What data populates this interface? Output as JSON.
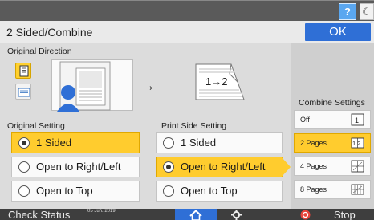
{
  "topbar": {
    "help_label": "?",
    "dark_mode_icon": "crescent-moon-icon"
  },
  "header": {
    "title": "2 Sided/Combine",
    "ok_label": "OK"
  },
  "original_direction": {
    "label": "Original Direction",
    "options": [
      {
        "icon": "portrait-document-icon",
        "selected": true
      },
      {
        "icon": "landscape-document-icon",
        "selected": false
      }
    ],
    "preview_icon": "original-on-glass-preview-icon",
    "flow_arrow": "→",
    "duplex_preview_text": "1→2"
  },
  "original_setting": {
    "label": "Original Setting",
    "options": [
      {
        "label": "1 Sided",
        "selected": true
      },
      {
        "label": "Open to Right/Left",
        "selected": false
      },
      {
        "label": "Open to Top",
        "selected": false
      }
    ]
  },
  "print_side_setting": {
    "label": "Print Side Setting",
    "options": [
      {
        "label": "1 Sided",
        "selected": false
      },
      {
        "label": "Open to Right/Left",
        "selected": true
      },
      {
        "label": "Open to Top",
        "selected": false
      }
    ]
  },
  "combine_settings": {
    "label": "Combine Settings",
    "options": [
      {
        "label": "Off",
        "selected": false,
        "icon": "combine-off-icon",
        "icon_text": "1"
      },
      {
        "label": "2 Pages",
        "selected": true,
        "icon": "combine-2-pages-icon",
        "icon_text": "1 2"
      },
      {
        "label": "4 Pages",
        "selected": false,
        "icon": "combine-4-pages-icon",
        "icon_text": ""
      },
      {
        "label": "8 Pages",
        "selected": false,
        "icon": "combine-8-pages-icon",
        "icon_text": ""
      }
    ]
  },
  "bottombar": {
    "check_status_label": "Check Status",
    "date_text": "05 Jun. 2019",
    "home_icon": "home-icon",
    "settings_icon": "gear-icon",
    "stop_icon": "stop-icon",
    "stop_label": "Stop"
  },
  "colors": {
    "selected": "#ffcc2e",
    "accent_blue": "#2f6fd6",
    "help_blue": "#5aa7f0"
  }
}
